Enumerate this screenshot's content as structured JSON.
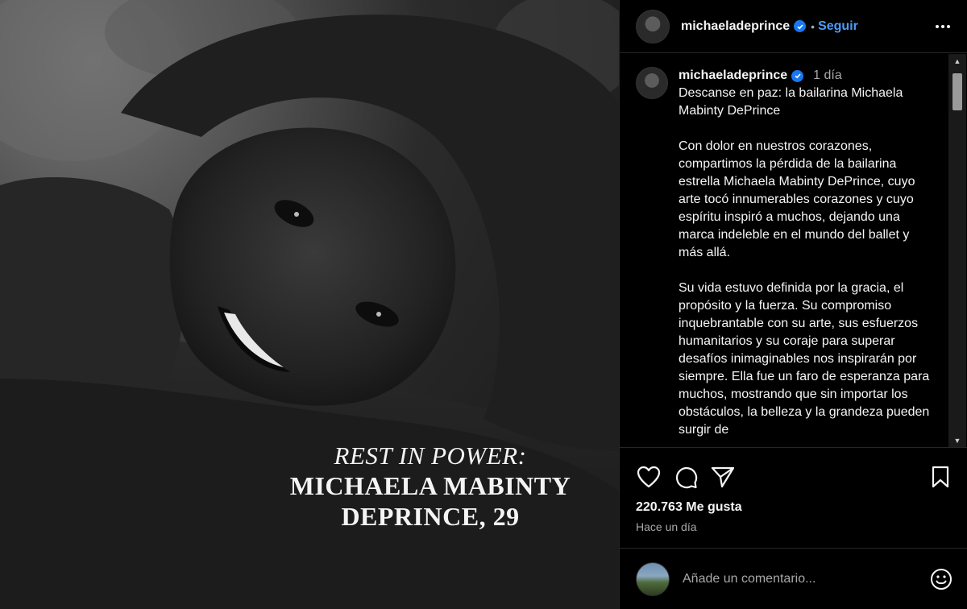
{
  "post_image": {
    "overlay_line1": "REST IN POWER:",
    "overlay_line2": "MICHAELA MABINTY",
    "overlay_line3": "DEPRINCE, 29"
  },
  "header": {
    "username": "michaeladeprince",
    "separator": "•",
    "follow_label": "Seguir",
    "more_icon": "more-horizontal-icon"
  },
  "caption": {
    "username": "michaeladeprince",
    "time": "1 día",
    "paragraphs": [
      "Descanse en paz: la bailarina Michaela Mabinty DePrince",
      "Con dolor en nuestros corazones, compartimos la pérdida de la bailarina estrella Michaela Mabinty DePrince, cuyo arte tocó innumerables corazones y cuyo espíritu inspiró a muchos, dejando una marca indeleble en el mundo del ballet y más allá.",
      "Su vida estuvo definida por la gracia, el propósito y la fuerza. Su compromiso inquebrantable con su arte, sus esfuerzos humanitarios y su coraje para superar desafíos inimaginables nos inspirarán por siempre. Ella fue un faro de esperanza para muchos, mostrando que sin importar los obstáculos, la belleza y la grandeza pueden surgir de"
    ]
  },
  "actions": {
    "like_icon": "heart-icon",
    "comment_icon": "comment-icon",
    "share_icon": "share-icon",
    "save_icon": "bookmark-icon"
  },
  "likes_text": "220.763 Me gusta",
  "posted_text": "Hace un día",
  "add_comment": {
    "placeholder": "Añade un comentario...",
    "emoji_icon": "emoji-icon"
  },
  "colors": {
    "background": "#000000",
    "accent_link": "#4a9cf7",
    "verified": "#1877f2",
    "muted_text": "#a8a8a8"
  }
}
